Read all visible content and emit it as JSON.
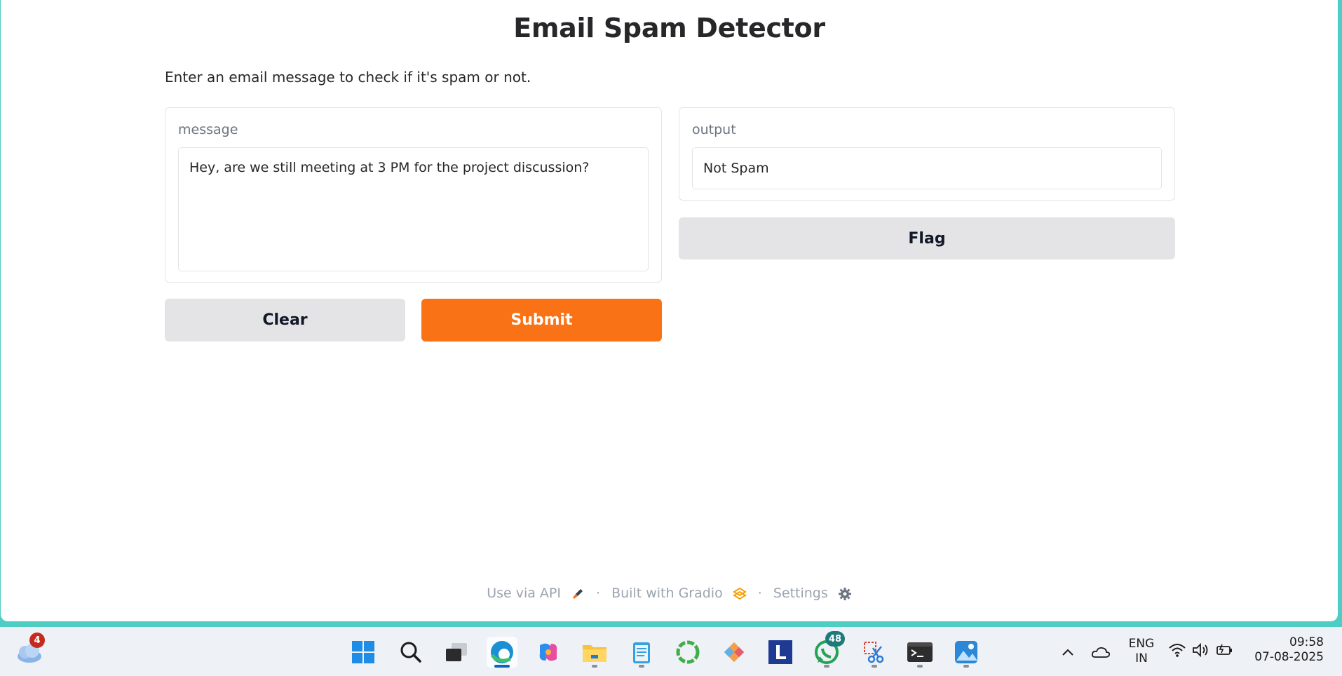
{
  "app": {
    "title": "Email Spam Detector",
    "description": "Enter an email message to check if it's spam or not."
  },
  "input": {
    "label": "message",
    "value": "Hey, are we still meeting at 3 PM for the project discussion?"
  },
  "output": {
    "label": "output",
    "value": "Not Spam"
  },
  "buttons": {
    "clear": "Clear",
    "submit": "Submit",
    "flag": "Flag"
  },
  "footer": {
    "api": "Use via API",
    "built": "Built with Gradio",
    "settings": "Settings",
    "separator": "·"
  },
  "taskbar": {
    "weather_badge": "4",
    "whatsapp_badge": "48",
    "lang_line1": "ENG",
    "lang_line2": "IN",
    "time": "09:58",
    "date": "07-08-2025",
    "icons": [
      "weather-icon",
      "start-icon",
      "search-icon",
      "task-view-icon",
      "edge-icon",
      "copilot-icon",
      "file-explorer-icon",
      "notepad-icon",
      "circle-app-icon",
      "git-icon",
      "l-app-icon",
      "whatsapp-icon",
      "snipping-tool-icon",
      "terminal-icon",
      "photos-icon"
    ]
  },
  "colors": {
    "primary": "#f97316",
    "secondary": "#e4e4e7",
    "background": "#4ecdc4"
  }
}
